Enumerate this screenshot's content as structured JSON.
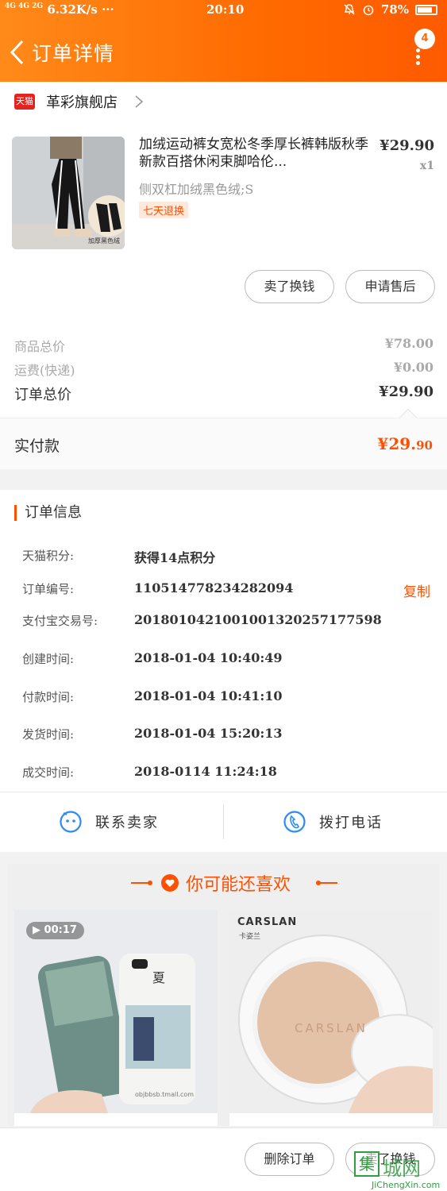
{
  "status_bar": {
    "network": "4G 4G 2G",
    "speed": "6.32K/s ···",
    "time": "20:10",
    "battery": "78%"
  },
  "nav": {
    "title": "订单详情",
    "badge_count": "4"
  },
  "store": {
    "platform_icon": "天猫",
    "name": "革彩旗舰店"
  },
  "item": {
    "title": "加绒运动裤女宽松冬季厚长裤韩版秋季新款百搭休闲束脚哈伦...",
    "sku": "侧双杠加绒黑色绒;S",
    "tag": "七天退换",
    "price": "¥29.90",
    "qty": "x1",
    "image_caption": "加厚黑色绒"
  },
  "item_actions": {
    "sell": "卖了换钱",
    "aftersale": "申请售后"
  },
  "summary": {
    "goods_label": "商品总价",
    "goods_value": "¥78.00",
    "shipping_label": "运费(快递)",
    "shipping_value": "¥0.00",
    "total_label": "订单总价",
    "total_value": "¥29.90",
    "paid_label": "实付款",
    "paid_main": "¥29.",
    "paid_cents": "90"
  },
  "order_info": {
    "heading": "订单信息",
    "rows": [
      {
        "label": "天猫积分:",
        "value": "获得14点积分"
      },
      {
        "label": "订单编号:",
        "value": "110514778234282094"
      },
      {
        "label": "支付宝交易号:",
        "value": "2018010421001001320257177598"
      },
      {
        "label": "创建时间:",
        "value": "2018-01-04 10:40:49"
      },
      {
        "label": "付款时间:",
        "value": "2018-01-04 10:41:10"
      },
      {
        "label": "发货时间:",
        "value": "2018-01-04 15:20:13"
      },
      {
        "label": "成交时间:",
        "value": "2018-0114 11:24:18"
      }
    ],
    "copy_label": "复制",
    "contact_seller": "联系卖家",
    "call_phone": "拨打电话"
  },
  "recommend": {
    "title": "你可能还喜欢",
    "cards": [
      {
        "video_duration": "00:17",
        "image_label": "夏",
        "image_caption": "objbbsb.tmall.com"
      },
      {
        "brand": "CARSLAN",
        "brand_sub": "卡姿兰",
        "image_caption": "CARSLAN"
      }
    ]
  },
  "bottom": {
    "delete": "删除订单",
    "buy_again": "卖了换钱"
  },
  "watermark": {
    "glyph": "集",
    "text": "城网",
    "url": "JiChengXin.com"
  },
  "colors": {
    "header_from": "#ff8a1a",
    "header_to": "#ff5a00",
    "accent": "#ff5000"
  }
}
